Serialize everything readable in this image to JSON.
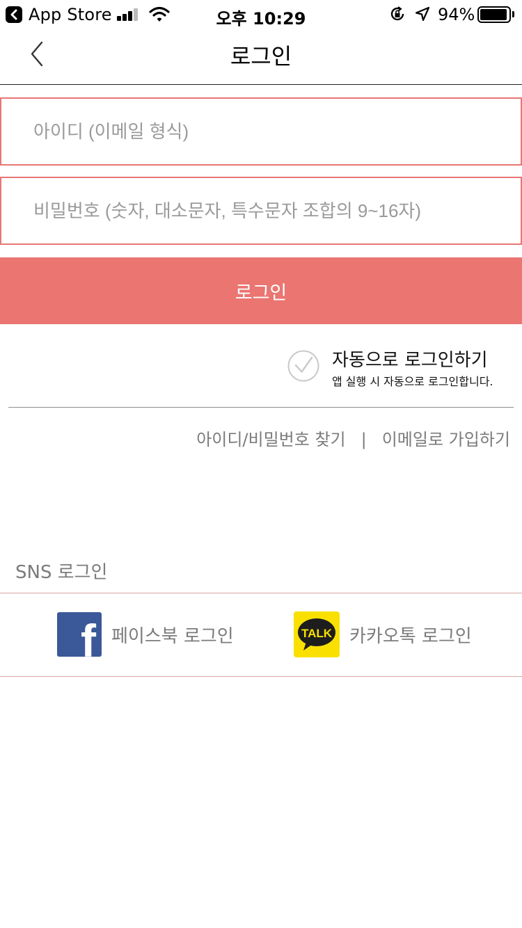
{
  "status_bar": {
    "back_app": "App Store",
    "time": "오후 10:29",
    "battery": "94%"
  },
  "nav": {
    "title": "로그인"
  },
  "form": {
    "id_placeholder": "아이디 (이메일 형식)",
    "pw_placeholder": "비밀번호 (숫자, 대소문자, 특수문자 조합의 9~16자)",
    "login_button": "로그인"
  },
  "auto_login": {
    "title": "자동으로 로그인하기",
    "description": "앱 실행 시 자동으로 로그인합니다."
  },
  "links": {
    "find": "아이디/비밀번호 찾기",
    "separator": "|",
    "signup": "이메일로 가입하기"
  },
  "sns": {
    "label": "SNS 로그인",
    "facebook": "페이스북 로그인",
    "facebook_logo": "f",
    "kakao": "카카오톡 로그인",
    "kakao_logo": "TALK"
  },
  "colors": {
    "accent": "#ea7571",
    "field_border": "#e87674",
    "facebook": "#3b5998",
    "kakao": "#f9e000"
  }
}
